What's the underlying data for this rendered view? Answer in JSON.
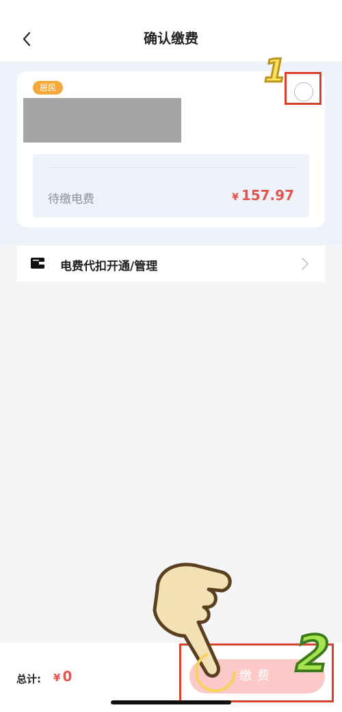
{
  "header": {
    "title": "确认缴费",
    "back_icon": "chevron-left-icon"
  },
  "account": {
    "tag": "居民",
    "due_label": "待缴电费",
    "due_currency": "¥",
    "due_amount": "157.97",
    "selected": false
  },
  "autopay": {
    "label": "电费代扣开通/管理",
    "icon": "wallet-icon"
  },
  "footer": {
    "total_label": "总计:",
    "total_currency": "¥",
    "total_amount": "0",
    "pay_label": "缴费"
  },
  "annotations": {
    "step1": "1",
    "step2": "2"
  },
  "colors": {
    "accent": "#e5534b",
    "tag": "#f5a93a",
    "pay_disabled": "#fbc9c7",
    "highlight": "#d9402b"
  }
}
